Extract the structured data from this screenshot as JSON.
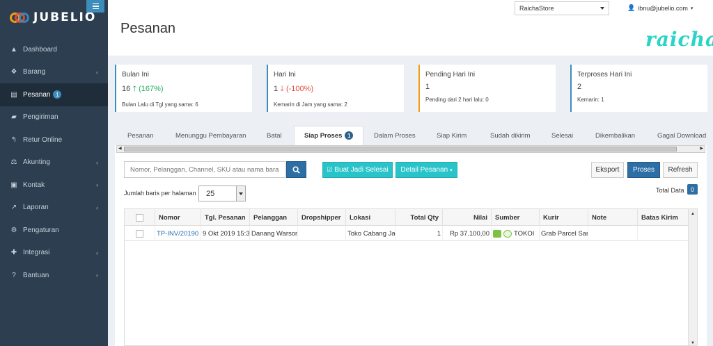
{
  "brand": {
    "name": "JUBELIO"
  },
  "sidebar": {
    "items": [
      {
        "label": "Dashboard",
        "icon": "area-chart-icon",
        "glyph": "▲",
        "chevron": ""
      },
      {
        "label": "Barang",
        "icon": "cubes-icon",
        "glyph": "❖",
        "chevron": "‹"
      },
      {
        "label": "Pesanan",
        "icon": "cart-icon",
        "glyph": "▤",
        "chevron": "",
        "badge": "1",
        "active": true
      },
      {
        "label": "Pengiriman",
        "icon": "truck-icon",
        "glyph": "▰",
        "chevron": ""
      },
      {
        "label": "Retur Online",
        "icon": "reply-icon",
        "glyph": "↰",
        "chevron": ""
      },
      {
        "label": "Akunting",
        "icon": "balance-scale-icon",
        "glyph": "⚖",
        "chevron": "‹"
      },
      {
        "label": "Kontak",
        "icon": "address-card-icon",
        "glyph": "▣",
        "chevron": "‹"
      },
      {
        "label": "Laporan",
        "icon": "line-chart-icon",
        "glyph": "↗",
        "chevron": "‹"
      },
      {
        "label": "Pengaturan",
        "icon": "cogs-icon",
        "glyph": "⚙",
        "chevron": ""
      },
      {
        "label": "Integrasi",
        "icon": "puzzle-icon",
        "glyph": "✚",
        "chevron": "‹"
      },
      {
        "label": "Bantuan",
        "icon": "question-circle-icon",
        "glyph": "?",
        "chevron": "‹"
      }
    ]
  },
  "header": {
    "title": "Pesanan",
    "store": "RaichaStore",
    "user": "ibnu@jubelio.com",
    "store_logo": "raicha"
  },
  "stats": [
    {
      "title": "Bulan Ini",
      "value": "16",
      "arrow": "🡑",
      "change": "(167%)",
      "trend": "up",
      "sub": "Bulan Lalu di Tgl yang sama: 6",
      "color": "#3c8dbc"
    },
    {
      "title": "Hari Ini",
      "value": "1",
      "arrow": "🡓",
      "change": "(-100%)",
      "trend": "down",
      "sub": "Kemarin di Jam yang sama: 2",
      "color": "#3c8dbc"
    },
    {
      "title": "Pending Hari Ini",
      "value": "1",
      "arrow": "",
      "change": "",
      "trend": "",
      "sub": "Pending dari 2 hari lalu: 0",
      "color": "#f39c12"
    },
    {
      "title": "Terproses Hari Ini",
      "value": "2",
      "arrow": "",
      "change": "",
      "trend": "",
      "sub": "Kemarin: 1",
      "color": "#3c8dbc"
    }
  ],
  "tabs": [
    {
      "label": "Pesanan"
    },
    {
      "label": "Menunggu Pembayaran"
    },
    {
      "label": "Batal"
    },
    {
      "label": "Siap Proses",
      "badge": "1",
      "active": true
    },
    {
      "label": "Dalam Proses"
    },
    {
      "label": "Siap Kirim"
    },
    {
      "label": "Sudah dikirim"
    },
    {
      "label": "Selesai"
    },
    {
      "label": "Dikembalikan"
    },
    {
      "label": "Gagal Download"
    }
  ],
  "toolbar": {
    "search_placeholder": "Nomor, Pelanggan, Channel, SKU atau nama barang",
    "buat_jadi_selesai": "Buat Jadi Selesai",
    "detail_pesanan": "Detail Pesanan",
    "eksport": "Eksport",
    "proses": "Proses",
    "refresh": "Refresh"
  },
  "paging": {
    "rows_label": "Jumlah baris per halaman",
    "rows_value": "25",
    "total_label": "Total Data",
    "total_value": "0"
  },
  "table": {
    "columns": [
      "Nomor",
      "Tgl. Pesanan",
      "Pelanggan",
      "Dropshipper",
      "Lokasi",
      "Total Qty",
      "Nilai",
      "Sumber",
      "Kurir",
      "Note",
      "Batas Kirim"
    ],
    "rows": [
      {
        "nomor": "TP-INV/20190",
        "tgl": "9 Okt 2019 15:3",
        "pelanggan": "Danang Warson",
        "dropshipper": "",
        "lokasi": "Toko Cabang Jak",
        "qty": "1",
        "nilai": "Rp 37.100,00",
        "sumber": "TOKOI",
        "kurir": "Grab Parcel Sam",
        "note": "",
        "batas": ""
      }
    ]
  }
}
